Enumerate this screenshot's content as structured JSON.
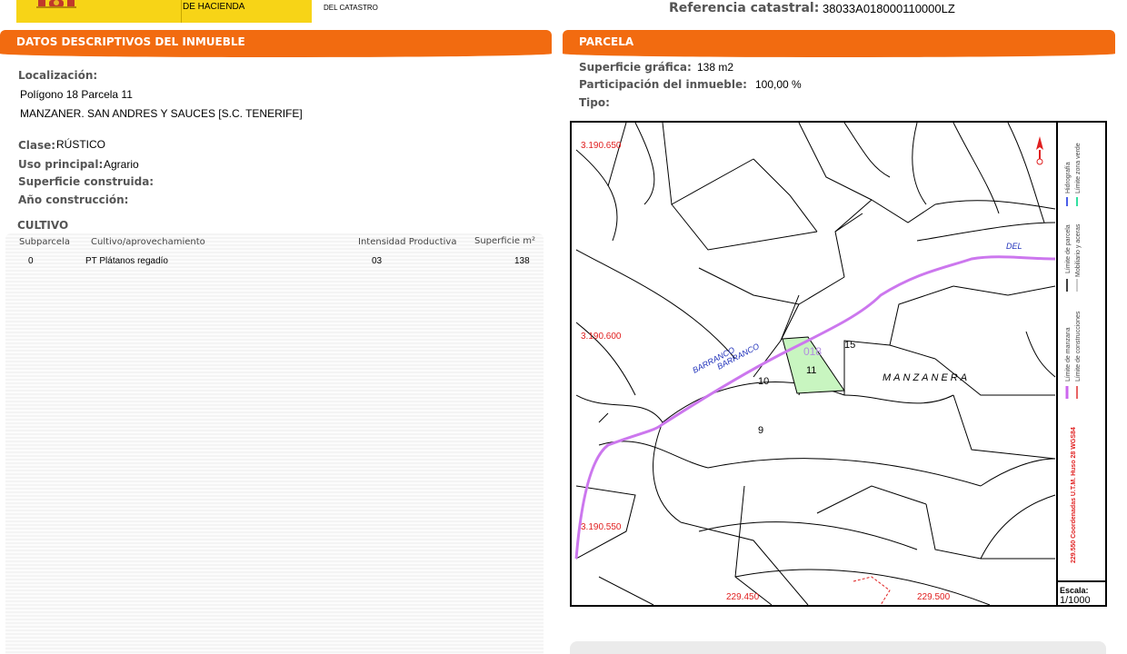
{
  "header": {
    "ministry_line": "DE HACIENDA",
    "directorate_line": "DEL CATASTRO",
    "reference_label": "Referencia catastral:",
    "reference_value": "38033A018000110000LZ"
  },
  "left_panel": {
    "title": "DATOS DESCRIPTIVOS DEL INMUEBLE",
    "localizacion_label": "Localización:",
    "localizacion_line1": "Polígono 18 Parcela 11",
    "localizacion_line2": "MANZANER. SAN ANDRES Y SAUCES [S.C. TENERIFE]",
    "clase_label": "Clase:",
    "clase_value": "RÚSTICO",
    "uso_label": "Uso principal:",
    "uso_value": "Agrario",
    "superficie_construida_label": "Superficie construida:",
    "anio_label": "Año construcción:",
    "cultivo_title": "CULTIVO",
    "table": {
      "headers": [
        "Subparcela",
        "Cultivo/aprovechamiento",
        "Intensidad Productiva",
        "Superficie m²"
      ],
      "rows": [
        [
          "0",
          "PT Plátanos regadío",
          "03",
          "138"
        ]
      ]
    }
  },
  "right_panel": {
    "title": "PARCELA",
    "superficie_grafica_label": "Superficie gráfica:",
    "superficie_grafica_value": "138 m2",
    "participacion_label": "Participación del inmueble:",
    "participacion_value": "100,00 %",
    "tipo_label": "Tipo:",
    "map": {
      "y_labels": [
        "3.190.650",
        "3.190.600",
        "3.190.550"
      ],
      "x_labels": [
        "229.450",
        "229.500"
      ],
      "parcel_numbers": [
        "018",
        "11",
        "10",
        "15",
        "9"
      ],
      "place_name": "MANZANERA",
      "stream_labels": [
        "BARRANCO",
        "BARRANCO",
        "DEL"
      ],
      "legend_items": [
        {
          "text": "Hidrografía",
          "color": "#4a5ee8"
        },
        {
          "text": "Límite zona verde",
          "color": "#33e0a0"
        },
        {
          "text": "Límite de parcela",
          "color": "#000000"
        },
        {
          "text": "Mobiliario y aceras",
          "color": "#bbbbbb"
        },
        {
          "text": "Límite de manzana",
          "color": "#cc66ee"
        },
        {
          "text": "Límite de construcciones",
          "color": "#e03030"
        }
      ],
      "coords_note": "229.550 Coordenadas U.T.M. Huso 28 WGS84",
      "scale_label": "Escala:",
      "scale_value": "1/1000",
      "colors": {
        "parcel_fill": "#c8f5c0",
        "block_boundary": "#cc77ee",
        "coord_text": "#e02020",
        "stream_text": "#2233bb"
      }
    }
  }
}
